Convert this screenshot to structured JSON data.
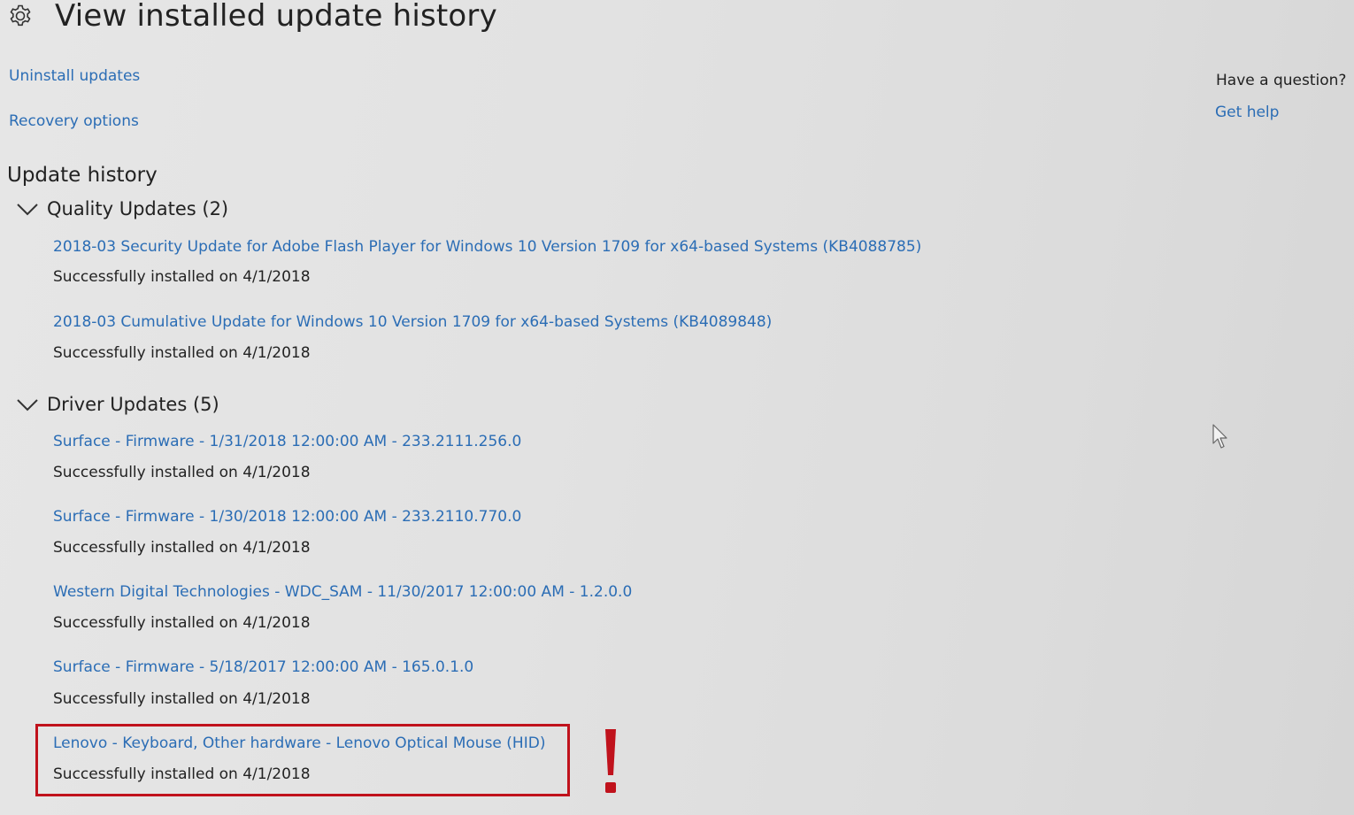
{
  "header": {
    "icon": "gear-icon",
    "title": "View installed update history"
  },
  "links": {
    "uninstall": "Uninstall updates",
    "recovery": "Recovery options"
  },
  "aside": {
    "question": "Have a question?",
    "help_link": "Get help"
  },
  "section_title": "Update history",
  "groups": [
    {
      "label": "Quality Updates (2)",
      "expanded": true,
      "items": [
        {
          "title": "2018-03 Security Update for Adobe Flash Player for Windows 10 Version 1709 for x64-based Systems (KB4088785)",
          "status": "Successfully installed on 4/1/2018"
        },
        {
          "title": "2018-03 Cumulative Update for Windows 10 Version 1709 for x64-based Systems (KB4089848)",
          "status": "Successfully installed on 4/1/2018"
        }
      ]
    },
    {
      "label": "Driver Updates (5)",
      "expanded": true,
      "items": [
        {
          "title": "Surface - Firmware - 1/31/2018 12:00:00 AM - 233.2111.256.0",
          "status": "Successfully installed on 4/1/2018"
        },
        {
          "title": "Surface - Firmware - 1/30/2018 12:00:00 AM - 233.2110.770.0",
          "status": "Successfully installed on 4/1/2018"
        },
        {
          "title": "Western Digital Technologies - WDC_SAM - 11/30/2017 12:00:00 AM - 1.2.0.0",
          "status": "Successfully installed on 4/1/2018"
        },
        {
          "title": "Surface - Firmware - 5/18/2017 12:00:00 AM - 165.0.1.0",
          "status": "Successfully installed on 4/1/2018"
        },
        {
          "title": "Lenovo - Keyboard, Other hardware - Lenovo Optical Mouse (HID)",
          "status": "Successfully installed on 4/1/2018",
          "highlighted": true
        }
      ]
    }
  ],
  "colors": {
    "link": "#2b6db5",
    "text": "#222222",
    "highlight": "#c0121c",
    "background": "#e3e3e3"
  }
}
